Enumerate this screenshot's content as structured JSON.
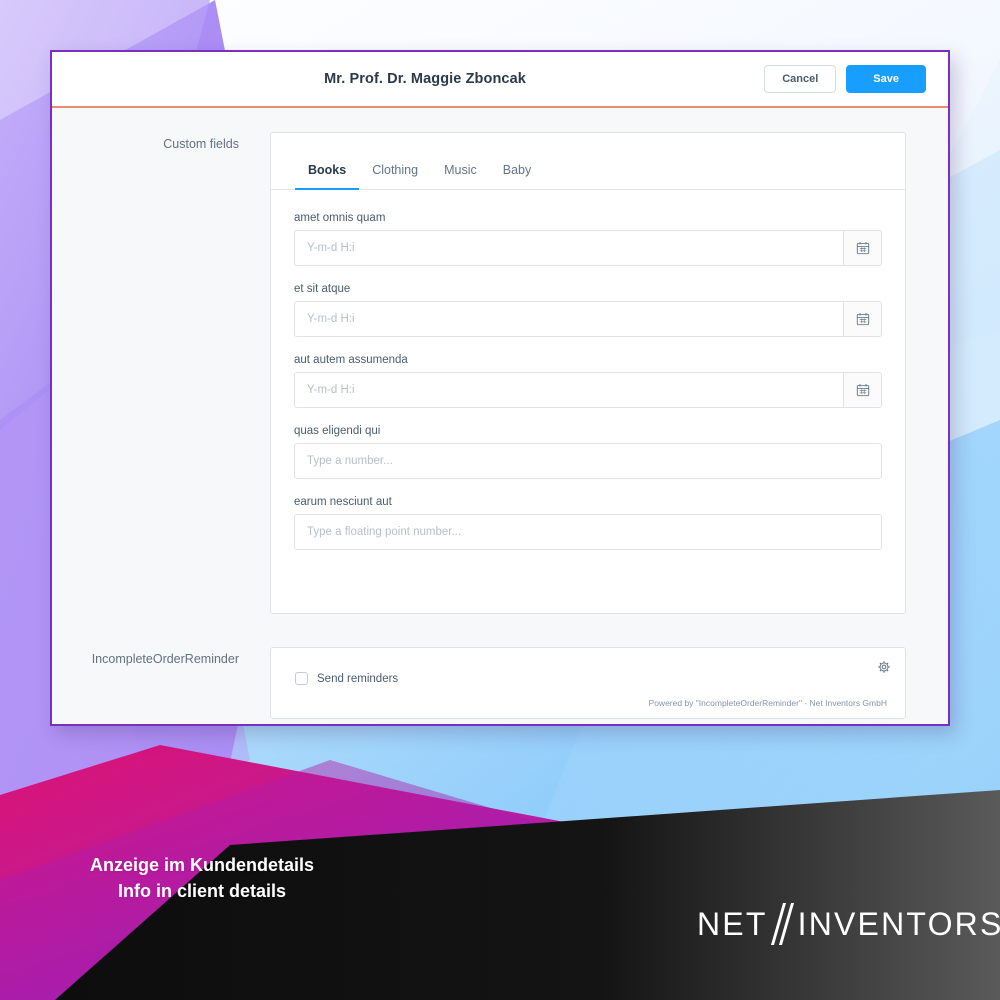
{
  "card": {
    "header": {
      "title": "Mr. Prof. Dr. Maggie Zboncak",
      "cancel_label": "Cancel",
      "save_label": "Save"
    },
    "sections": [
      {
        "label": "Custom fields"
      },
      {
        "label": "IncompleteOrderReminder"
      }
    ],
    "custom_fields": {
      "tabs": [
        {
          "label": "Books",
          "active": true
        },
        {
          "label": "Clothing",
          "active": false
        },
        {
          "label": "Music",
          "active": false
        },
        {
          "label": "Baby",
          "active": false
        }
      ],
      "fields": [
        {
          "label": "amet omnis quam",
          "placeholder": "Y-m-d H:i",
          "type": "datetime",
          "value": ""
        },
        {
          "label": "et sit atque",
          "placeholder": "Y-m-d H:i",
          "type": "datetime",
          "value": ""
        },
        {
          "label": "aut autem assumenda",
          "placeholder": "Y-m-d H:i",
          "type": "datetime",
          "value": ""
        },
        {
          "label": "quas eligendi qui",
          "placeholder": "Type a number...",
          "type": "number",
          "value": ""
        },
        {
          "label": "earum nesciunt aut",
          "placeholder": "Type a floating point number...",
          "type": "float",
          "value": ""
        }
      ],
      "calendar_icon": "calendar-icon"
    },
    "reminder": {
      "gear_icon": "gear-icon",
      "checkbox_label": "Send reminders",
      "checkbox_checked": false,
      "powered_by": "Powered by \"IncompleteOrderReminder\" - Net Inventors GmbH"
    }
  },
  "banner": {
    "line1": "Anzeige im Kundendetails",
    "line2": "Info in client details"
  },
  "logo": {
    "part1": "NET",
    "part2": "INVENTORS"
  },
  "colors": {
    "card_border": "#7b2fbe",
    "header_divider": "#e98971",
    "primary": "#189eff",
    "banner_magenta": "#d2177f",
    "banner_purple": "#8b21d6",
    "black_panel": "#111111",
    "sky_blue": "#7fc4fb"
  }
}
